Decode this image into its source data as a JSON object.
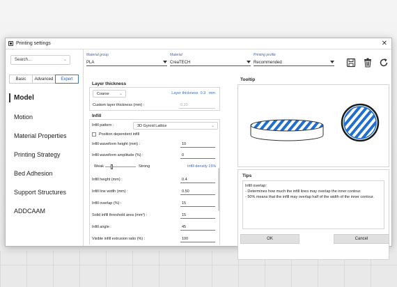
{
  "window": {
    "title": "Printing settings"
  },
  "search": {
    "value": "Search..."
  },
  "tabs": [
    {
      "label": "Basic",
      "active": false
    },
    {
      "label": "Advanced",
      "active": false
    },
    {
      "label": "Expert",
      "active": true
    }
  ],
  "nav": [
    {
      "label": "Model",
      "active": true
    },
    {
      "label": "Motion",
      "active": false
    },
    {
      "label": "Material Properties",
      "active": false
    },
    {
      "label": "Printing Strategy",
      "active": false
    },
    {
      "label": "Bed Adhesion",
      "active": false
    },
    {
      "label": "Support Structures",
      "active": false
    },
    {
      "label": "ADDCAAM",
      "active": false
    }
  ],
  "header": {
    "material_group": {
      "label": "Material group",
      "value": "PLA"
    },
    "material": {
      "label": "Material",
      "value": "CreaTECH"
    },
    "printing_profile": {
      "label": "Printing profile",
      "value": "Recommended"
    },
    "icons": [
      "save-icon",
      "delete-icon",
      "refresh-icon"
    ]
  },
  "layer_thickness": {
    "title": "Layer thickness",
    "preset": "Coarse",
    "readout_label": "Layer thickness",
    "readout_value": "0.3",
    "readout_unit": "mm",
    "custom_label": "Custom layer thickness (mm) :",
    "custom_value": "0.20"
  },
  "infill": {
    "title": "Infill",
    "pattern_label": "Infill pattern :",
    "pattern_value": "3D Gyroid Lattice",
    "position_dependent_label": "Position dependent infill",
    "position_dependent_checked": false,
    "waveform_height_label": "Infill waveform height (mm) :",
    "waveform_height_value": "10",
    "waveform_amplitude_label": "Infill waveform amplitude (%) :",
    "waveform_amplitude_value": "0",
    "slider_weak": "Weak",
    "slider_strong": "Strong",
    "slider_level": 0.2,
    "density_label": "Infill density",
    "density_value": "15%",
    "fields": [
      {
        "label": "Infill height (mm) :",
        "value": "0.4"
      },
      {
        "label": "Infill line width (mm) :",
        "value": "0.50"
      },
      {
        "label": "Infill overlap (%) :",
        "value": "15"
      },
      {
        "label": "Solid infill threshold area (mm²) :",
        "value": "15"
      },
      {
        "label": "Infill angle :",
        "value": "45"
      },
      {
        "label": "Visible infill extrusion ratio (%) :",
        "value": "100"
      }
    ]
  },
  "tooltip": {
    "title": "Tooltip",
    "tips_title": "Tips",
    "tips_heading": "Infill overlap:",
    "tips_lines": [
      "- Determines how much the infill lines may overlap the inner contour.",
      "- 50% means that the infill may overlap half of the width of the inner contour."
    ],
    "colors": {
      "accent": "#1f6fd1"
    }
  },
  "buttons": {
    "ok": "OK",
    "cancel": "Cancel"
  }
}
